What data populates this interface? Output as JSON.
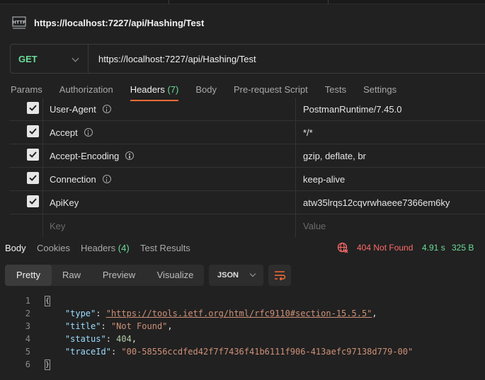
{
  "request": {
    "title": "https://localhost:7227/api/Hashing/Test",
    "icon": "http-request-icon",
    "method": "GET",
    "url": "https://localhost:7227/api/Hashing/Test"
  },
  "tabs": [
    {
      "label": "Params"
    },
    {
      "label": "Authorization"
    },
    {
      "label": "Headers",
      "count": "(7)"
    },
    {
      "label": "Body"
    },
    {
      "label": "Pre-request Script"
    },
    {
      "label": "Tests"
    },
    {
      "label": "Settings"
    }
  ],
  "headers_table": {
    "rows": [
      {
        "key": "User-Agent",
        "value": "PostmanRuntime/7.45.0",
        "checked": true
      },
      {
        "key": "Accept",
        "value": "*/*",
        "checked": true
      },
      {
        "key": "Accept-Encoding",
        "value": "gzip, deflate, br",
        "checked": true
      },
      {
        "key": "Connection",
        "value": "keep-alive",
        "checked": true
      },
      {
        "key": "ApiKey",
        "value": "atw35lrqs12cqvrwhaeee7366em6ky",
        "checked": true
      }
    ],
    "key_placeholder": "Key",
    "value_placeholder": "Value"
  },
  "response": {
    "tabs": [
      {
        "label": "Body"
      },
      {
        "label": "Cookies"
      },
      {
        "label": "Headers",
        "count": "(4)"
      },
      {
        "label": "Test Results"
      }
    ],
    "status": "404 Not Found",
    "time": "4.91 s",
    "size": "325 B",
    "view_modes": [
      "Pretty",
      "Raw",
      "Preview",
      "Visualize"
    ],
    "format": "JSON",
    "body_lines": [
      {
        "n": "1"
      },
      {
        "n": "2",
        "key": "\"type\"",
        "value": "\"https://tools.ietf.org/html/rfc9110#section-15.5.5\""
      },
      {
        "n": "3",
        "key": "\"title\"",
        "value": "\"Not Found\""
      },
      {
        "n": "4",
        "key": "\"status\"",
        "value": "404"
      },
      {
        "n": "5",
        "key": "\"traceId\"",
        "value": "\"00-58556ccdfed42f7f7436f41b6111f906-413aefc97138d779-00\""
      },
      {
        "n": "6"
      }
    ]
  },
  "colors": {
    "accent": "#ff6c37",
    "method_get": "#6bdd9a",
    "status_error": "#ff6b6b",
    "meta_green": "#6bdd9a"
  }
}
